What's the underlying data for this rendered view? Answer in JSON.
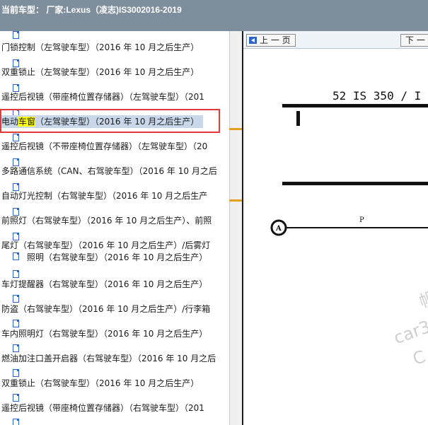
{
  "titlebar": {
    "title": "当前车型：  厂家:Lexus（凌志)IS3002016-2019"
  },
  "tree": {
    "items": [
      {
        "label": "门锁控制（左驾驶车型）（2016 年 10 月之后生产）"
      },
      {
        "label": "双重锁止（左驾驶车型）（2016 年 10 月之后生产）"
      },
      {
        "label": "遥控后视镜（带座椅位置存储器）（左驾驶车型）（201"
      },
      {
        "label_before": "电动",
        "label_hl": "车窗",
        "label_after": "（左驾驶车型）（2016 年 10 月之后生产）"
      },
      {
        "label": "遥控后视镜（不带座椅位置存储器）（左驾驶车型）（20"
      },
      {
        "label": "多路通信系统（CAN、右驾驶车型）（2016 年 10 月之后"
      },
      {
        "label": "自动灯光控制（右驾驶车型）（2016 年 10 月之后生产"
      },
      {
        "label": "前照灯（右驾驶车型）（2016 年 10 月之后生产）、前照"
      },
      {
        "label": "尾灯（右驾驶车型）（2016 年 10 月之后生产）/后雾灯"
      },
      {
        "label": "照明（右驾驶车型）（2016 年 10 月之后生产）"
      },
      {
        "label": "车灯提醒器（右驾驶车型）（2016 年 10 月之后生产）"
      },
      {
        "label": "防盗（右驾驶车型）（2016 年 10 月之后生产）/行李箱"
      },
      {
        "label": "车内照明灯（右驾驶车型）（2016 年 10 月之后生产）"
      },
      {
        "label": "燃油加注口盖开启器（右驾驶车型）（2016 年 10 月之后"
      },
      {
        "label": "双重锁止（右驾驶车型）（2016 年 10 月之后生产）"
      },
      {
        "label": "遥控后视镜（带座椅位置存储器）（右驾驶车型）（201"
      }
    ]
  },
  "viewer": {
    "prev_button": "上 一 页",
    "next_button": "下 一",
    "diagram_title": "52   IS 350 / I",
    "connector_label": "A",
    "wire_label": "P",
    "watermark_1": "帆",
    "watermark_2": "car3",
    "watermark_3": "C"
  },
  "colors": {
    "titlebar_bg": "#7f8e9c",
    "selection_bg": "#c8d8ea",
    "highlight": "#ffff00",
    "focus_box": "#e33a3a"
  }
}
